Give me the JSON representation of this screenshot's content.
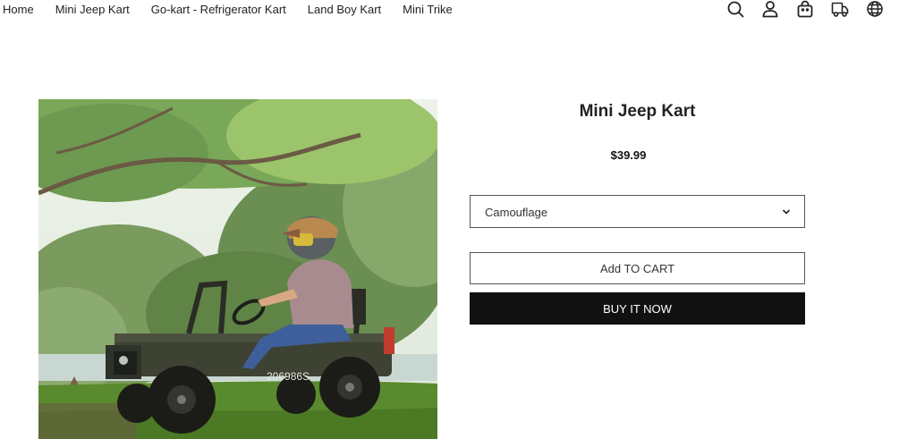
{
  "nav": {
    "links": [
      "Home",
      "Mini Jeep Kart",
      "Go-kart - Refrigerator Kart",
      "Land Boy Kart",
      "Mini Trike"
    ],
    "icons": [
      "search-icon",
      "account-icon",
      "cart-icon",
      "truck-icon",
      "globe-icon"
    ]
  },
  "product": {
    "title": "Mini Jeep Kart",
    "price": "$39.99",
    "variant": "Camouflage",
    "add_to_cart": "Add TO CART",
    "buy_now": "BUY IT NOW",
    "vehicle_number": "206986S"
  },
  "colors": {
    "accent_dark": "#111111",
    "border": "#555555"
  }
}
